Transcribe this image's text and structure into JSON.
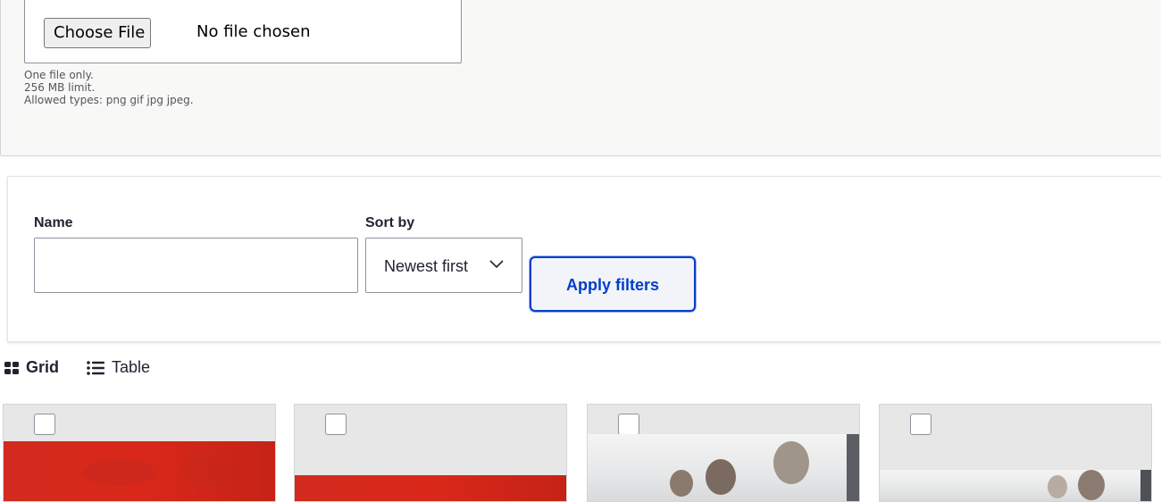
{
  "upload": {
    "choose_button": "Choose File",
    "status": "No file chosen",
    "help_lines": [
      "One file only.",
      "256 MB limit.",
      "Allowed types: png gif jpg jpeg."
    ]
  },
  "filters": {
    "name_label": "Name",
    "name_value": "",
    "sort_label": "Sort by",
    "sort_selected": "Newest first",
    "apply_button": "Apply filters"
  },
  "view_toggle": {
    "grid_label": "Grid",
    "table_label": "Table",
    "active": "grid"
  },
  "grid": {
    "items": [
      {
        "checked": false,
        "thumbnail": "red-map-graphic"
      },
      {
        "checked": false,
        "thumbnail": "red-map-graphic"
      },
      {
        "checked": false,
        "thumbnail": "business-people-photo"
      },
      {
        "checked": false,
        "thumbnail": "business-people-photo"
      }
    ]
  },
  "colors": {
    "accent": "#003ecc",
    "thumbnail_red": "#d22a1e",
    "card_header": "#e7e7e7"
  }
}
